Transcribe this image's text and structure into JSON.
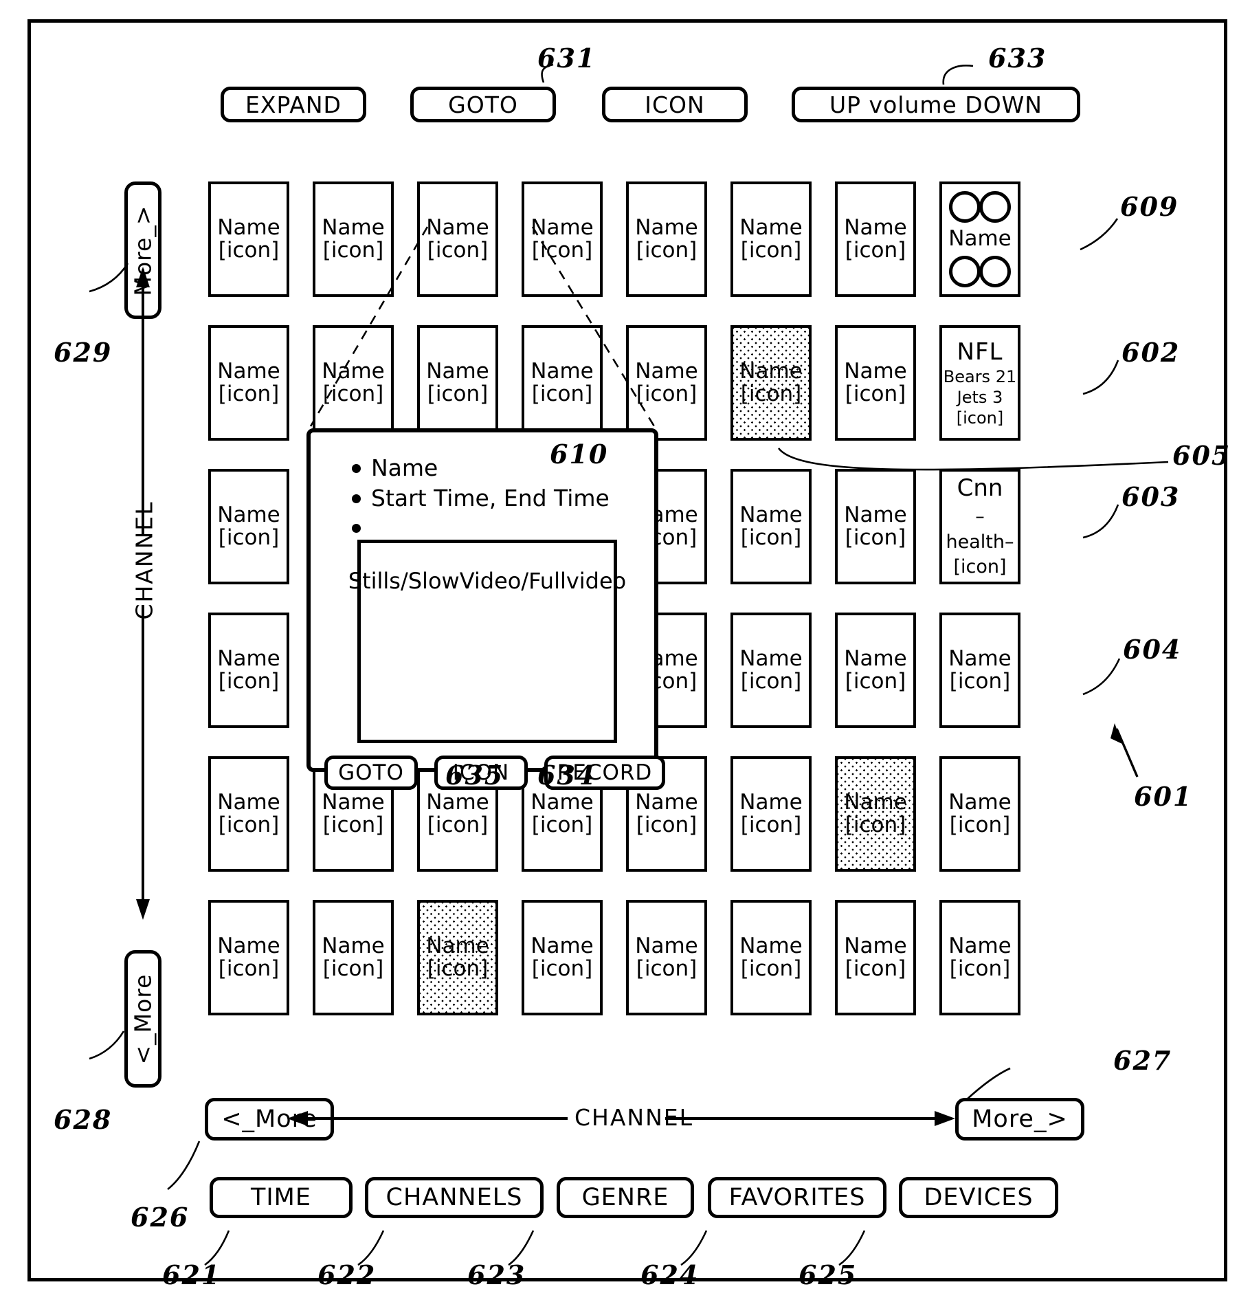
{
  "figure": {
    "ref_main": "601"
  },
  "top_buttons": [
    {
      "label": "EXPAND",
      "ref": ""
    },
    {
      "label": "GOTO",
      "ref": "631"
    },
    {
      "label": "ICON",
      "ref": ""
    },
    {
      "label": "UP volume DOWN",
      "ref": "633"
    }
  ],
  "grid": {
    "cell_default": {
      "line1": "Name",
      "line2": "[icon]"
    },
    "rows": [
      [
        {
          "type": "default"
        },
        {
          "type": "default"
        },
        {
          "type": "default"
        },
        {
          "type": "default"
        },
        {
          "type": "default"
        },
        {
          "type": "default"
        },
        {
          "type": "default"
        },
        {
          "type": "quad",
          "name": "Name",
          "ref": "609"
        }
      ],
      [
        {
          "type": "default"
        },
        {
          "type": "default"
        },
        {
          "type": "default"
        },
        {
          "type": "default"
        },
        {
          "type": "default"
        },
        {
          "type": "shaded"
        },
        {
          "type": "default"
        },
        {
          "type": "nfl",
          "title": "NFL",
          "score1": "Bears 21",
          "score2": "Jets 3",
          "icon": "[icon]",
          "ref": "602"
        }
      ],
      [
        {
          "type": "default"
        },
        {
          "type": "default"
        },
        {
          "type": "default"
        },
        {
          "type": "default"
        },
        {
          "type": "default"
        },
        {
          "type": "default"
        },
        {
          "type": "default"
        },
        {
          "type": "cnn",
          "title": "Cnn",
          "sub": "–health–",
          "icon": "[icon]",
          "ref": "603"
        }
      ],
      [
        {
          "type": "default"
        },
        {
          "type": "default"
        },
        {
          "type": "default"
        },
        {
          "type": "default"
        },
        {
          "type": "default"
        },
        {
          "type": "default"
        },
        {
          "type": "default"
        },
        {
          "type": "default",
          "ref": "604"
        }
      ],
      [
        {
          "type": "default"
        },
        {
          "type": "default"
        },
        {
          "type": "default"
        },
        {
          "type": "default"
        },
        {
          "type": "default"
        },
        {
          "type": "default"
        },
        {
          "type": "shaded"
        },
        {
          "type": "default"
        }
      ],
      [
        {
          "type": "default"
        },
        {
          "type": "default"
        },
        {
          "type": "shaded"
        },
        {
          "type": "default"
        },
        {
          "type": "default"
        },
        {
          "type": "default"
        },
        {
          "type": "default"
        },
        {
          "type": "default"
        }
      ]
    ]
  },
  "side_nav": {
    "up_button": {
      "label": "More_>",
      "ref": "629"
    },
    "down_button": {
      "label": "<_More",
      "ref": "628"
    },
    "axis_label": "CHANNEL"
  },
  "bottom_nav": {
    "left_button": {
      "label": "<_More",
      "ref": "626"
    },
    "right_button": {
      "label": "More_>",
      "ref": "627"
    },
    "axis_label": "CHANNEL"
  },
  "bottom_buttons": [
    {
      "label": "TIME",
      "ref": "621"
    },
    {
      "label": "CHANNELS",
      "ref": "622"
    },
    {
      "label": "GENRE",
      "ref": "623"
    },
    {
      "label": "FAVORITES",
      "ref": "624"
    },
    {
      "label": "DEVICES",
      "ref": "625"
    }
  ],
  "popup": {
    "ref": "610",
    "bullets": [
      "Name",
      "Start Time, End Time",
      ""
    ],
    "video_label": "Stills/SlowVideo/Fullvideo",
    "buttons": [
      {
        "label": "GOTO",
        "ref": ""
      },
      {
        "label": "ICON",
        "ref": "635"
      },
      {
        "label": "RECORD",
        "ref": "634"
      }
    ]
  },
  "leader_refs": {
    "shaded_cell_ref": "605"
  }
}
